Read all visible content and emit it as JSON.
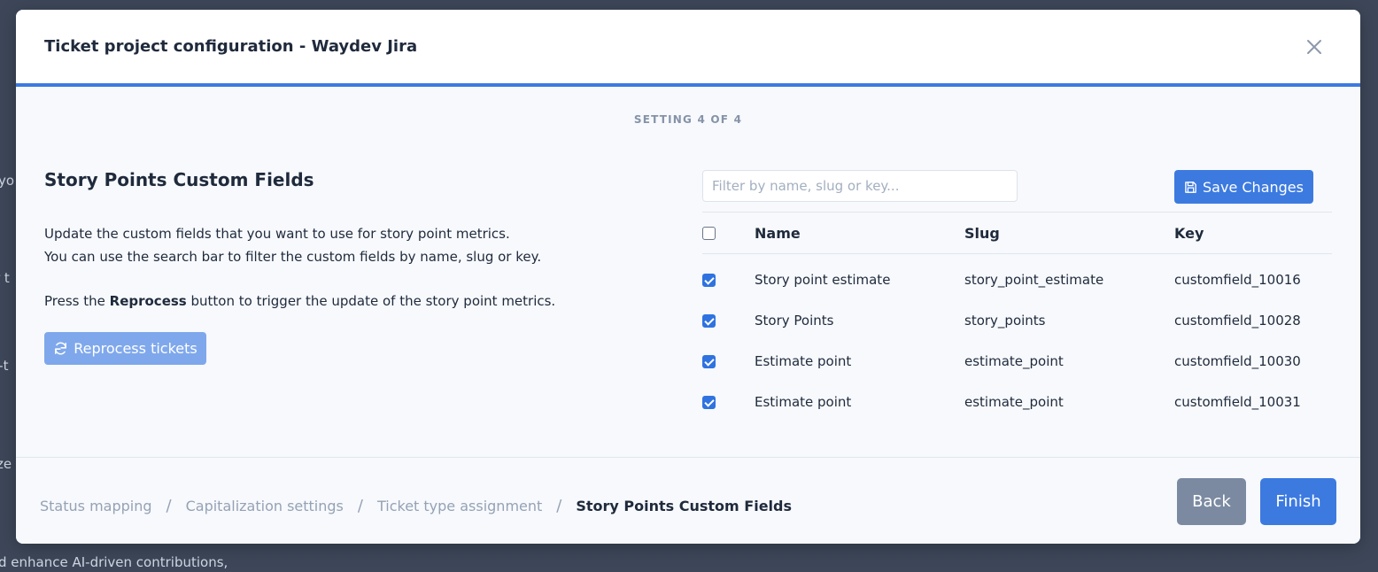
{
  "background": {
    "fragments": [
      "yo",
      "r t",
      "l-t",
      "ze",
      "d enhance AI-driven contributions,"
    ]
  },
  "modal": {
    "title": "Ticket project configuration - Waydev Jira",
    "step": "SETTING 4 OF 4",
    "section_title": "Story Points Custom Fields",
    "description_line1": "Update the custom fields that you want to use for story point metrics.",
    "description_line2": "You can use the search bar to filter the custom fields by name, slug or key.",
    "reprocess_prefix": "Press the ",
    "reprocess_bold": "Reprocess",
    "reprocess_suffix": " button to trigger the update of the story point metrics.",
    "reprocess_button": "Reprocess tickets",
    "filter_placeholder": "Filter by name, slug or key...",
    "save_button": "Save Changes"
  },
  "table": {
    "columns": [
      "Name",
      "Slug",
      "Key"
    ],
    "rows": [
      {
        "name": "Story point estimate",
        "slug": "story_point_estimate",
        "key": "customfield_10016",
        "checked": true
      },
      {
        "name": "Story Points",
        "slug": "story_points",
        "key": "customfield_10028",
        "checked": true
      },
      {
        "name": "Estimate point",
        "slug": "estimate_point",
        "key": "customfield_10030",
        "checked": true
      },
      {
        "name": "Estimate point",
        "slug": "estimate_point",
        "key": "customfield_10031",
        "checked": true
      }
    ]
  },
  "footer": {
    "breadcrumbs": [
      "Status mapping",
      "Capitalization settings",
      "Ticket type assignment",
      "Story Points Custom Fields"
    ],
    "separator": "/",
    "back_button": "Back",
    "finish_button": "Finish"
  },
  "colors": {
    "accent": "#3c7ae0",
    "overlay": "#3d4759",
    "back_button": "#7b8aa1"
  }
}
